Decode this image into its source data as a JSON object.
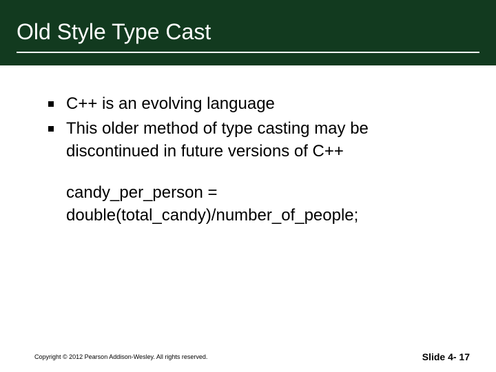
{
  "title": "Old Style Type Cast",
  "bullets": [
    "C++ is an evolving language",
    "This older method of type casting may be discontinued in future versions of C++"
  ],
  "code": {
    "line1": "candy_per_person =",
    "line2": "double(total_candy)/number_of_people;"
  },
  "footer": {
    "copyright": "Copyright © 2012 Pearson Addison-Wesley. All rights reserved.",
    "slide_label": "Slide 4- 17"
  }
}
